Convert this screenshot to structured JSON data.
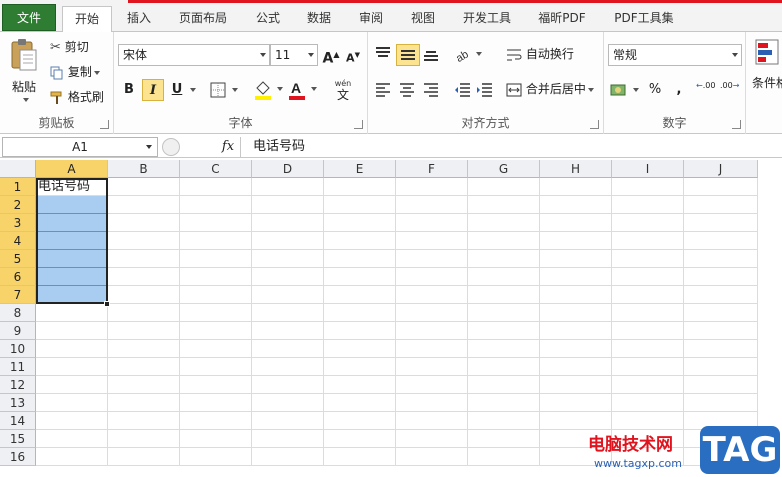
{
  "tabs": {
    "file": "文件",
    "items": [
      "开始",
      "插入",
      "页面布局",
      "公式",
      "数据",
      "审阅",
      "视图",
      "开发工具",
      "福昕PDF",
      "PDF工具集"
    ]
  },
  "clipboard": {
    "paste": "粘贴",
    "cut": "剪切",
    "copy": "复制",
    "format_painter": "格式刷",
    "label": "剪贴板"
  },
  "font": {
    "name": "宋体",
    "size": "11",
    "bold": "B",
    "italic": "I",
    "underline": "U",
    "grow": "A",
    "shrink": "A",
    "phonetic": "wén",
    "label": "字体"
  },
  "alignment": {
    "wrap": "自动换行",
    "merge": "合并后居中",
    "label": "对齐方式"
  },
  "number": {
    "format": "常规",
    "percent": "%",
    "comma": ",",
    "inc_decimal": ".00",
    "dec_decimal": ".00",
    "label": "数字"
  },
  "styles": {
    "conditional": "条件格"
  },
  "formula_bar": {
    "name_box": "A1",
    "fx": "fx",
    "content": "电话号码"
  },
  "grid": {
    "columns": [
      "A",
      "B",
      "C",
      "D",
      "E",
      "F",
      "G",
      "H",
      "I",
      "J"
    ],
    "rows": [
      "1",
      "2",
      "3",
      "4",
      "5",
      "6",
      "7",
      "8",
      "9",
      "10",
      "11",
      "12",
      "13",
      "14",
      "15",
      "16"
    ],
    "a1_value": "电话号码"
  },
  "watermark": {
    "text": "电脑技术网",
    "url": "www.tagxp.com",
    "tag": "TAG"
  },
  "colors": {
    "file_tab": "#2f7d32",
    "selection_fill": "#a9cdf1",
    "header_selected": "#f7d36a",
    "brand_red": "#e0141e",
    "tag_blue": "#2a6ec1"
  }
}
